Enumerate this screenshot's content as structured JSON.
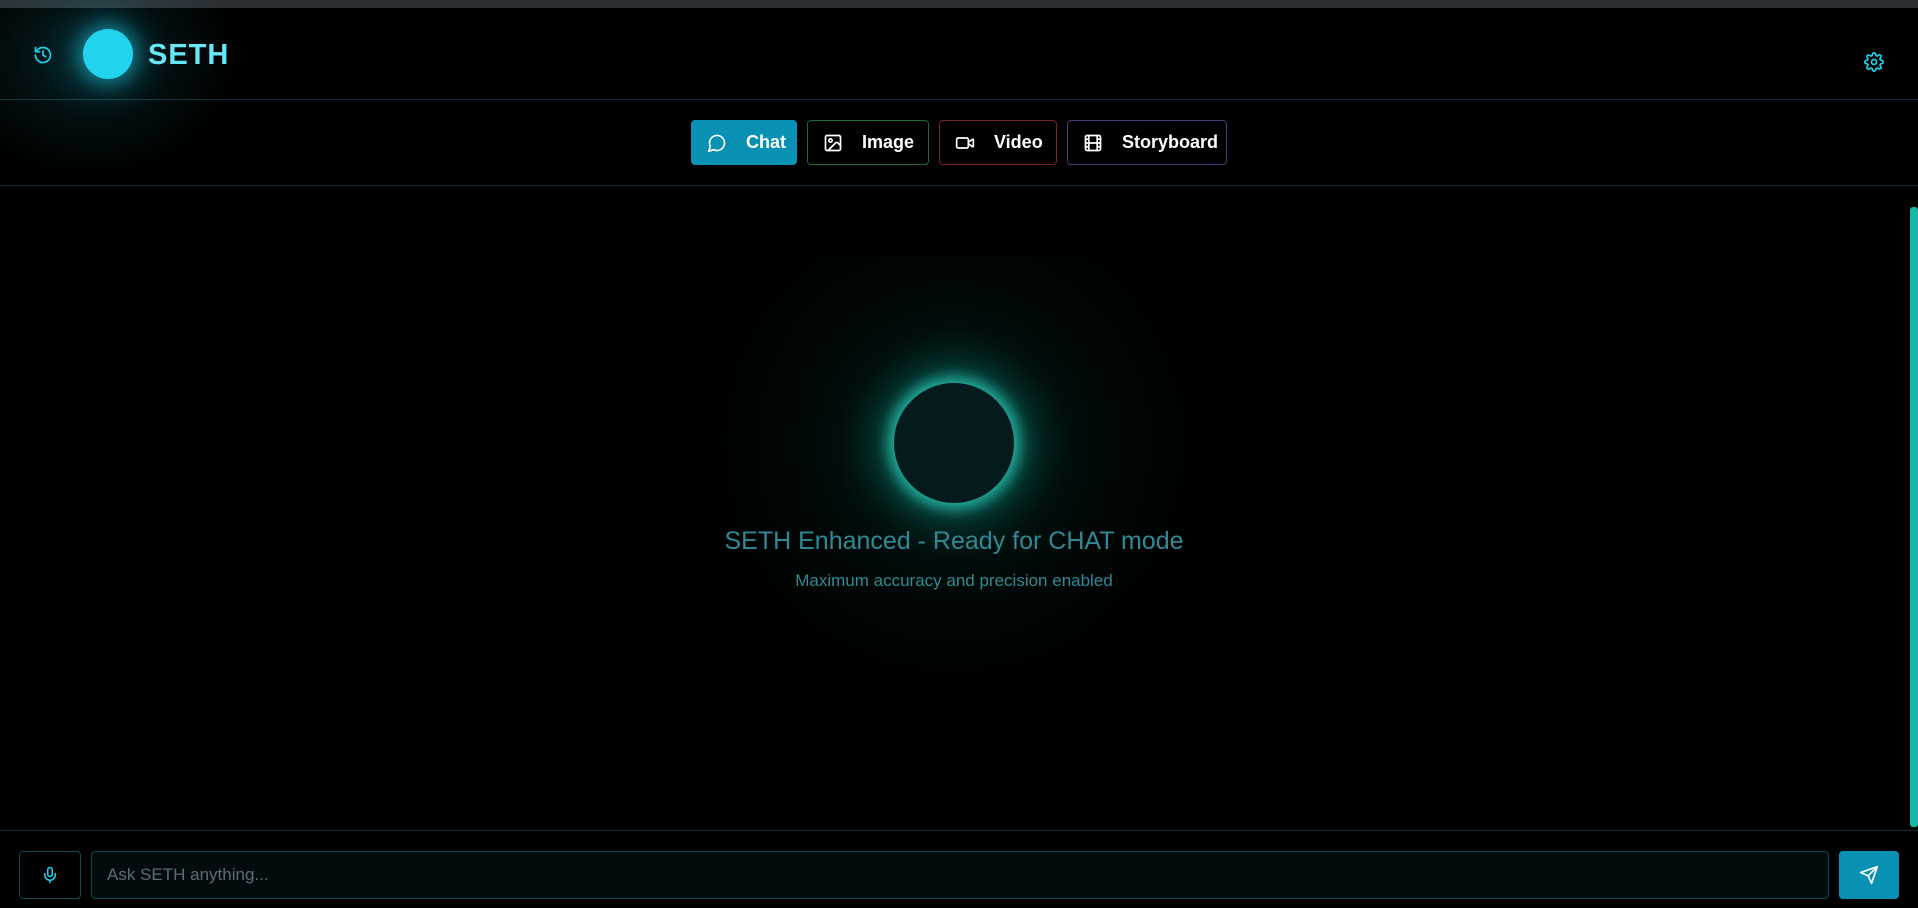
{
  "header": {
    "brand": "SETH",
    "history_icon": "history-icon",
    "settings_icon": "gear-icon"
  },
  "modes": [
    {
      "label": "Chat",
      "icon": "message-circle-icon",
      "active": true
    },
    {
      "label": "Image",
      "icon": "image-icon",
      "active": false
    },
    {
      "label": "Video",
      "icon": "video-camera-icon",
      "active": false
    },
    {
      "label": "Storyboard",
      "icon": "film-icon",
      "active": false
    }
  ],
  "main": {
    "title": "SETH Enhanced - Ready for CHAT mode",
    "subtitle": "Maximum accuracy and precision enabled"
  },
  "composer": {
    "placeholder": "Ask SETH anything...",
    "value": "",
    "mic_icon": "microphone-icon",
    "send_icon": "send-icon"
  },
  "colors": {
    "accent": "#22d3ee",
    "active_mode": "#0891b2",
    "glow": "#14b8a6",
    "image_border": "#1c6b3a",
    "video_border": "#7a2222",
    "storyboard_border": "#4b3a78"
  }
}
